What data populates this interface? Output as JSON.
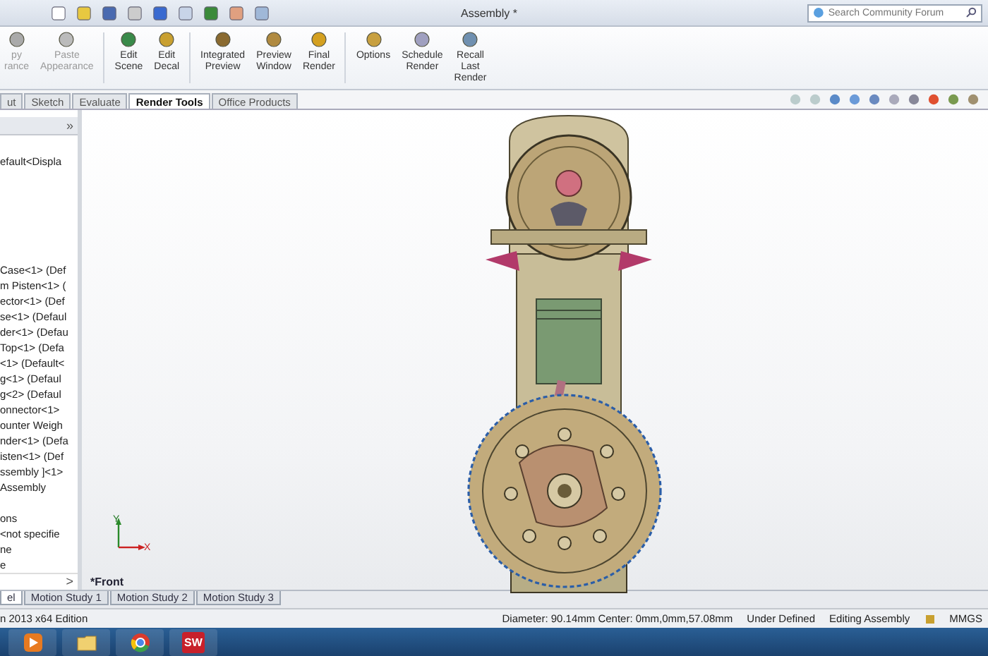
{
  "window": {
    "title": "Assembly *"
  },
  "search": {
    "placeholder": "Search Community Forum"
  },
  "ribbon": [
    {
      "label": "py\nrance",
      "disabled": true
    },
    {
      "label": "Paste\nAppearance",
      "disabled": true
    },
    {
      "label": "Edit\nScene",
      "disabled": false
    },
    {
      "label": "Edit\nDecal",
      "disabled": false
    },
    {
      "label": "Integrated\nPreview",
      "disabled": false
    },
    {
      "label": "Preview\nWindow",
      "disabled": false
    },
    {
      "label": "Final\nRender",
      "disabled": false
    },
    {
      "label": "Options",
      "disabled": false
    },
    {
      "label": "Schedule\nRender",
      "disabled": false
    },
    {
      "label": "Recall\nLast\nRender",
      "disabled": false
    }
  ],
  "tabs": [
    {
      "label": "ut",
      "selected": false
    },
    {
      "label": "Sketch",
      "selected": false
    },
    {
      "label": "Evaluate",
      "selected": false
    },
    {
      "label": "Render Tools",
      "selected": true
    },
    {
      "label": "Office Products",
      "selected": false
    }
  ],
  "feature_tree": {
    "expand_label": "»",
    "collapse_label": ">",
    "items": [
      "efault<Displa",
      "Case<1> (Def",
      "m Pisten<1> (",
      "ector<1> (Def",
      "se<1> (Defaul",
      "der<1> (Defau",
      "Top<1> (Defa",
      "<1> (Default<",
      "g<1> (Defaul",
      "g<2> (Defaul",
      "onnector<1>",
      "ounter Weigh",
      "nder<1> (Defa",
      "isten<1> (Def",
      "ssembly ]<1>",
      "Assembly",
      "ons",
      "<not specifie",
      "ne",
      "e"
    ]
  },
  "viewport": {
    "view_label": "*Front",
    "axis_x": "X",
    "axis_y": "Y"
  },
  "bottom_tabs": [
    {
      "label": "el",
      "selected": true
    },
    {
      "label": "Motion Study 1",
      "selected": false
    },
    {
      "label": "Motion Study 2",
      "selected": false
    },
    {
      "label": "Motion Study 3",
      "selected": false
    }
  ],
  "status_bar": {
    "edition": "n 2013 x64 Edition",
    "measure": "Diameter: 90.14mm  Center: 0mm,0mm,57.08mm",
    "state": "Under Defined",
    "mode": "Editing Assembly",
    "units": "MMGS"
  },
  "taskbar": [
    {
      "kind": "media"
    },
    {
      "kind": "folder"
    },
    {
      "kind": "browser"
    },
    {
      "kind": "app",
      "label": "SW"
    }
  ]
}
